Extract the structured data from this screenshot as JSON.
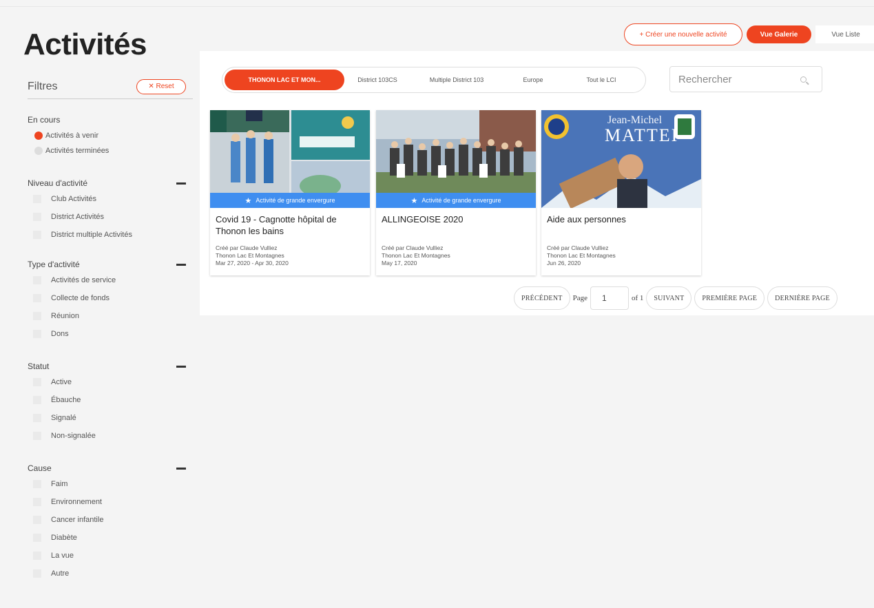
{
  "header": {
    "title": "Activités",
    "create_label": "+ Créer une nouvelle activité",
    "gallery_label": "Vue Galerie",
    "list_label": "Vue Liste"
  },
  "filters": {
    "title": "Filtres",
    "reset_label": "✕ Reset",
    "en_cours": {
      "title": "En cours",
      "options": [
        "Activités à venir",
        "Activités terminées"
      ]
    },
    "niveau": {
      "title": "Niveau d'activité",
      "options": [
        "Club Activités",
        "District Activités",
        "District multiple Activités"
      ]
    },
    "type": {
      "title": "Type d'activité",
      "options": [
        "Activités de service",
        "Collecte de fonds",
        "Réunion",
        "Dons"
      ]
    },
    "statut": {
      "title": "Statut",
      "options": [
        "Active",
        "Ébauche",
        "Signalé",
        "Non-signalée"
      ]
    },
    "cause": {
      "title": "Cause",
      "options": [
        "Faim",
        "Environnement",
        "Cancer infantile",
        "Diabète",
        "La vue",
        "Autre"
      ]
    }
  },
  "scope": {
    "tabs": [
      "THONON LAC ET MON...",
      "District 103CS",
      "Multiple District 103",
      "Europe",
      "Tout le LCI"
    ]
  },
  "search": {
    "placeholder": "Rechercher"
  },
  "cards": [
    {
      "banner": "Activité de grande envergure",
      "title": "Covid 19 - Cagnotte hôpital de Thonon les bains",
      "created_by": "Créé par Claude Vulliez",
      "club": "Thonon Lac Et Montagnes",
      "dates": "Mar 27, 2020 - Apr 30, 2020"
    },
    {
      "banner": "Activité de grande envergure",
      "title": "ALLINGEOISE 2020",
      "created_by": "Créé par Claude Vulliez",
      "club": "Thonon Lac Et Montagnes",
      "dates": "May 17, 2020"
    },
    {
      "banner": "",
      "title": "Aide aux personnes",
      "created_by": "Créé par Claude Vulliez",
      "club": "Thonon Lac Et Montagnes",
      "dates": "Jun 26, 2020",
      "poster_name_1": "Jean-Michel",
      "poster_name_2": "MATTEI"
    }
  ],
  "pager": {
    "prev": "PRÉCÉDENT",
    "page_label": "Page",
    "page_value": "1",
    "of_label": "of 1",
    "next": "SUIVANT",
    "first": "PREMIÈRE PAGE",
    "last": "DERNIÈRE PAGE"
  },
  "colors": {
    "accent": "#ee4420",
    "banner": "#3f8ef0"
  }
}
